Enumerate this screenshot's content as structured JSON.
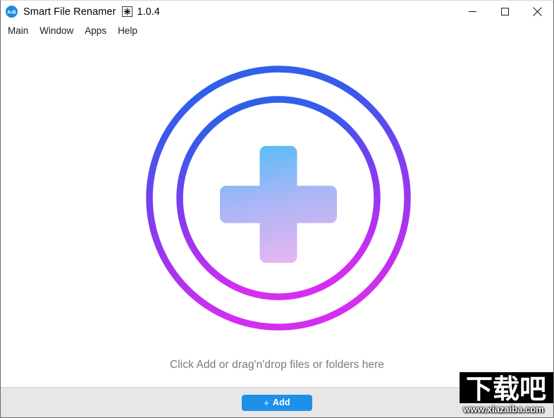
{
  "window": {
    "title": "Smart File Renamer",
    "version": "1.0.4",
    "app_icon_name": "app-logo-icon",
    "version_badge_icon": "asterisk-badge-icon",
    "controls": {
      "minimize": "Minimize",
      "maximize": "Maximize",
      "close": "Close"
    }
  },
  "menubar": {
    "items": [
      {
        "label": "Main"
      },
      {
        "label": "Window"
      },
      {
        "label": "Apps"
      },
      {
        "label": "Help"
      }
    ]
  },
  "dropzone": {
    "hint": "Click Add or drag'n'drop files or folders here",
    "graphic_icon": "plus-in-circles-icon",
    "colors": {
      "ring_gradient_start": "#2766e8",
      "ring_gradient_end": "#d42ef0",
      "plus_gradient_start": "#62bdf6",
      "plus_gradient_end": "#e3b7f2"
    }
  },
  "footer": {
    "add_button": {
      "plus": "+",
      "label": "Add",
      "color": "#1e90e8"
    }
  },
  "watermark": {
    "logo_text": "下载吧",
    "url": "www.xiazaiba.com"
  }
}
